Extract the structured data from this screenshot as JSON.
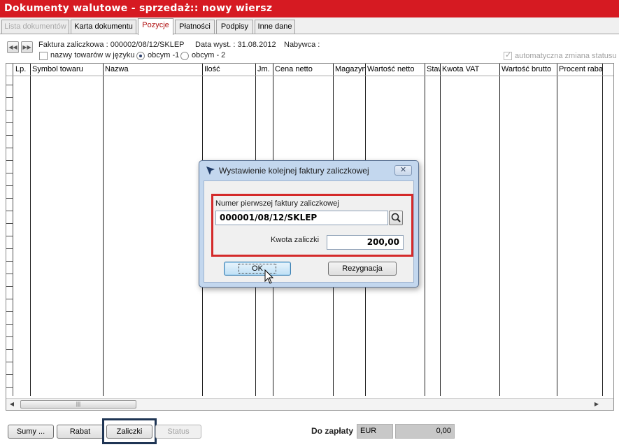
{
  "window": {
    "title": "Dokumenty walutowe - sprzedaż:: nowy wiersz"
  },
  "tabs": [
    {
      "label": "Lista dokumentów",
      "state": "disabled"
    },
    {
      "label": "Karta dokumentu",
      "state": "normal"
    },
    {
      "label": "Pozycje",
      "state": "active"
    },
    {
      "label": "Płatności",
      "state": "normal"
    },
    {
      "label": "Podpisy",
      "state": "normal"
    },
    {
      "label": "Inne dane",
      "state": "normal"
    }
  ],
  "info": {
    "faktura": "Faktura zaliczkowa : 000002/08/12/SKLEP",
    "data_wyst": "Data wyst. : 31.08.2012",
    "nabywca": "Nabywca :",
    "nazwy_towarow": "nazwy towarów w języku",
    "obcym1": "obcym -1",
    "obcym2": "obcym - 2",
    "auto_status": "automatyczna zmiana statusu",
    "nav_prev_icon": "rewind-icon",
    "nav_next_icon": "fast-forward-icon"
  },
  "grid": {
    "columns": [
      "Lp.",
      "Symbol towaru",
      "Nazwa",
      "Ilość",
      "Jm.",
      "Cena netto",
      "Magazyn",
      "Wartość netto",
      "Staw",
      "Kwota VAT",
      "Wartość brutto",
      "Procent raba"
    ]
  },
  "dialog": {
    "title": "Wystawienie kolejnej faktury zaliczkowej",
    "close_icon": "close-icon",
    "first_invoice_label": "Numer pierwszej faktury zaliczkowej",
    "first_invoice_value": "000001/08/12/SKLEP",
    "advance_label": "Kwota zaliczki",
    "advance_value": "200,00",
    "ok": "OK",
    "cancel": "Rezygnacja"
  },
  "bottom": {
    "sumy": "Sumy ...",
    "rabat": "Rabat",
    "zaliczki": "Zaliczki",
    "status": "Status",
    "do_zaplaty": "Do zapłaty",
    "currency": "EUR",
    "amount": "0,00"
  },
  "colors": {
    "titlebar": "#d61a22",
    "highlight_box": "#d42a2a",
    "focus_ring": "#1f3554"
  }
}
